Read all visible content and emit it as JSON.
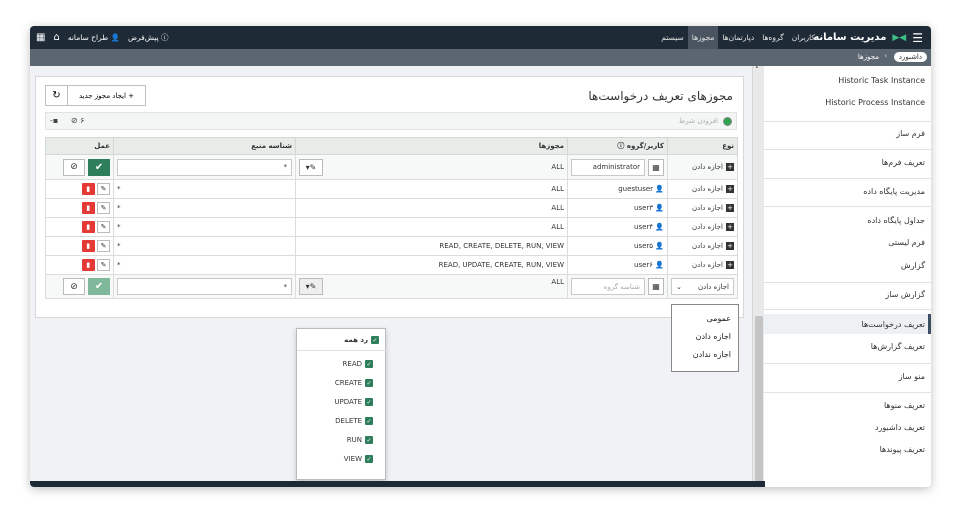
{
  "app": {
    "title": "مدیریت سامانه",
    "menu": [
      "کاربران",
      "گروه‌ها",
      "دپارتمان‌ها",
      "مجوزها",
      "سیستم"
    ],
    "active_menu": "مجوزها",
    "user": "طراح سامانه",
    "lang": "پیش‌فرض"
  },
  "breadcrumb": {
    "home": "داشبورد",
    "current": "مجوزها"
  },
  "sidebar": {
    "items": [
      "Historic Task Instance",
      "Historic Process Instance",
      "فرم ساز",
      "تعریف فرم‌ها",
      "مدیریت پایگاه داده",
      "جداول پایگاه داده",
      "فرم لیستی",
      "گزارش",
      "گزارش ساز",
      "تعریف درخواست‌ها",
      "تعریف گزارش‌ها",
      "منو ساز",
      "تعریف منوها",
      "تعریف داشبورد",
      "تعریف پیوندها"
    ],
    "active": "تعریف درخواست‌ها"
  },
  "page": {
    "title": "مجوزهای تعریف درخواست‌ها",
    "new_button": "+ ایجاد مجوز جدید",
    "filter_placeholder": "افزودن شرط",
    "filter_count": "۶"
  },
  "table": {
    "headers": {
      "type": "نوع",
      "user": "کاربر/گروه",
      "perms": "مجوزها",
      "resource": "شناسه منبع",
      "action": "عمل"
    },
    "edit_row": {
      "type": "اجازه دادن",
      "user": "administrator",
      "perms": "ALL",
      "resource": "*"
    },
    "rows": [
      {
        "type": "اجازه دادن",
        "user": "guestuser",
        "perms": "ALL",
        "resource": "*"
      },
      {
        "type": "اجازه دادن",
        "user": "user۳",
        "perms": "ALL",
        "resource": "*"
      },
      {
        "type": "اجازه دادن",
        "user": "user۴",
        "perms": "ALL",
        "resource": "*"
      },
      {
        "type": "اجازه دادن",
        "user": "user۵",
        "perms": "READ, CREATE, DELETE, RUN, VIEW",
        "resource": "*"
      },
      {
        "type": "اجازه دادن",
        "user": "user۶",
        "perms": "READ, UPDATE, CREATE, RUN, VIEW",
        "resource": "*"
      }
    ],
    "add_row": {
      "type": "اجازه دادن",
      "user_placeholder": "شناسه گروه",
      "perms": "ALL",
      "resource": "*"
    }
  },
  "perm_popup": {
    "toggle_all": "رد همه",
    "options": [
      "READ",
      "CREATE",
      "UPDATE",
      "DELETE",
      "RUN",
      "VIEW"
    ]
  },
  "type_menu": {
    "options": [
      "عمومی",
      "اجازه دادن",
      "اجازه ندادن"
    ]
  }
}
